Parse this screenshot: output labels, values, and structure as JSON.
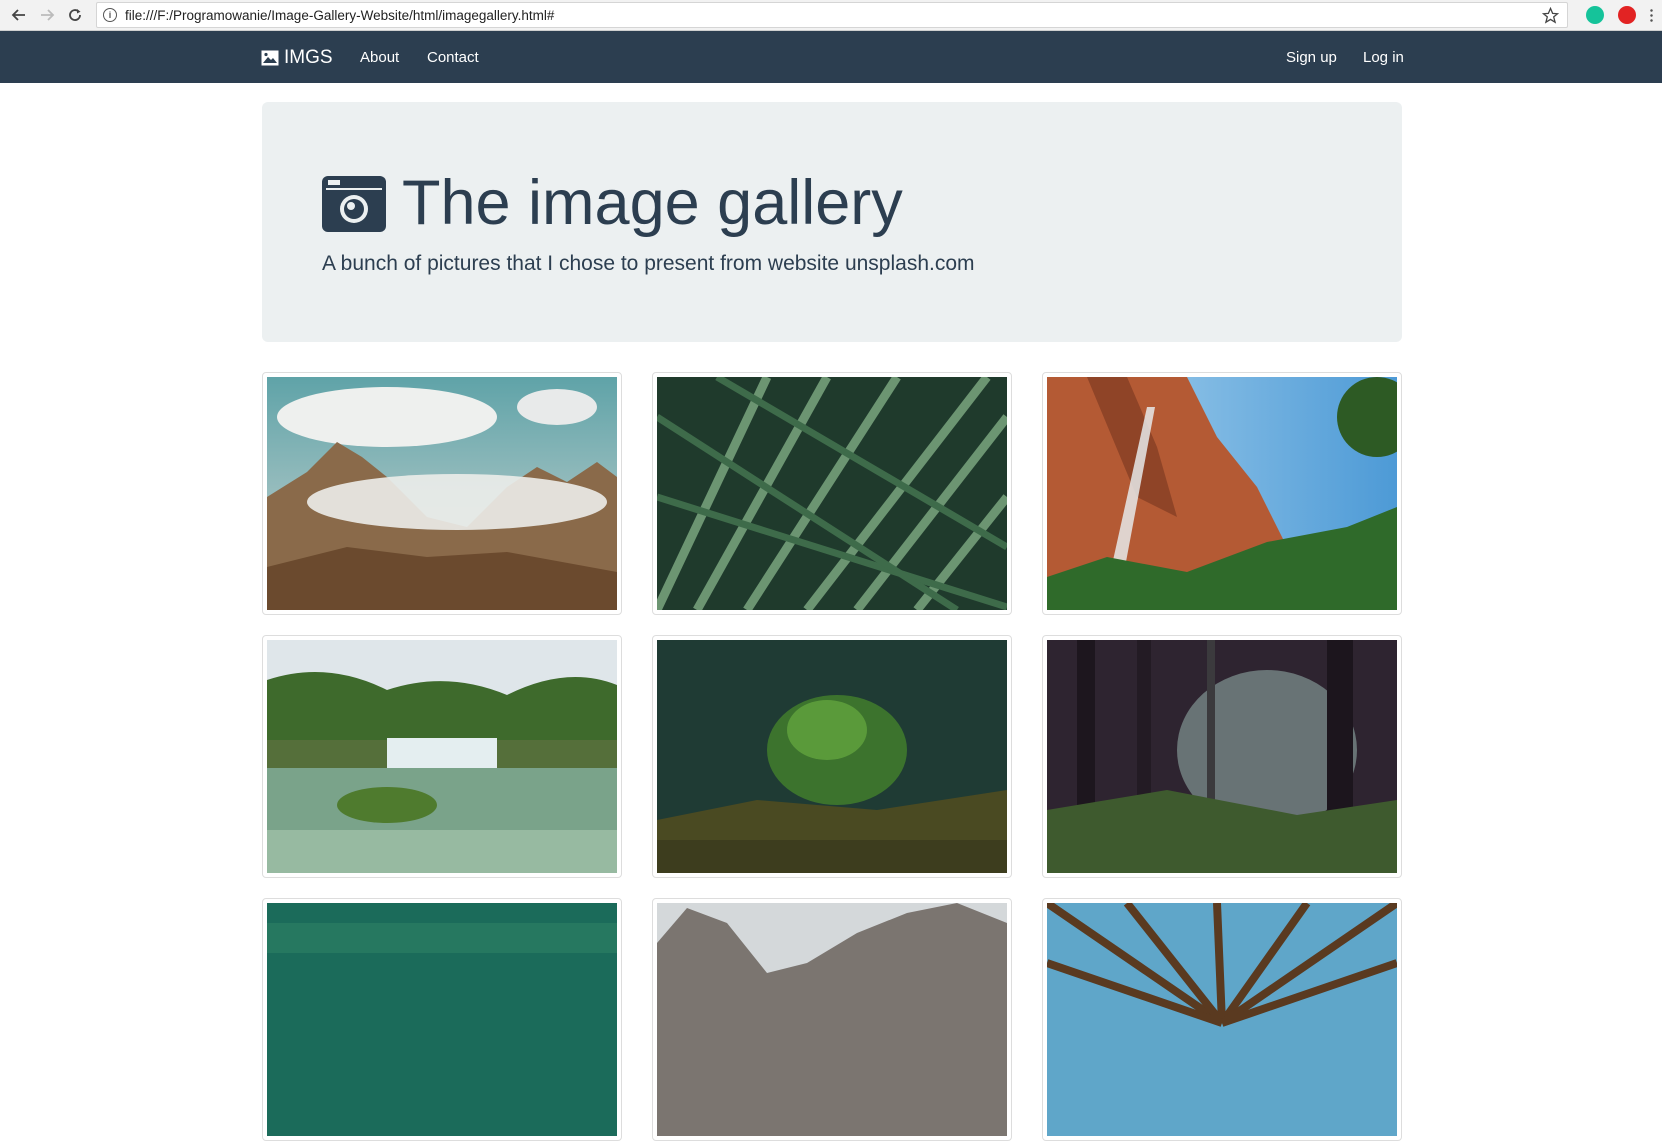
{
  "browser": {
    "url": "file:///F:/Programowanie/Image-Gallery-Website/html/imagegallery.html#"
  },
  "navbar": {
    "brand": "IMGS",
    "links": [
      "About",
      "Contact"
    ],
    "right_links": [
      "Sign up",
      "Log in"
    ],
    "color": "#2c3e50"
  },
  "jumbotron": {
    "title": "The image gallery",
    "subtitle": "A bunch of pictures that I chose to present from website unsplash.com",
    "background": "#ecf0f1"
  },
  "gallery": {
    "images": [
      {
        "subject": "mountain-clouds"
      },
      {
        "subject": "palm-leaves"
      },
      {
        "subject": "canyon-waterfall"
      },
      {
        "subject": "river-waterfalls"
      },
      {
        "subject": "small-fir-tree"
      },
      {
        "subject": "misty-forest"
      },
      {
        "subject": "green-water"
      },
      {
        "subject": "rocky-mountains"
      },
      {
        "subject": "tree-canopy"
      }
    ]
  }
}
